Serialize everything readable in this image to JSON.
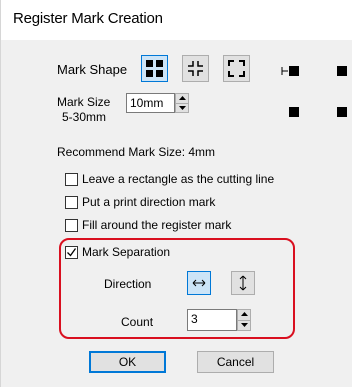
{
  "window": {
    "title": "Register Mark Creation"
  },
  "mark_shape": {
    "label": "Mark Shape",
    "options": [
      {
        "name": "square-blocks",
        "selected": true
      },
      {
        "name": "corner-cross",
        "selected": false
      },
      {
        "name": "corner-brackets",
        "selected": false
      }
    ]
  },
  "mark_size": {
    "label": "Mark Size",
    "range": "5-30mm",
    "value": "10mm"
  },
  "recommend": {
    "text": "Recommend Mark Size:  4mm"
  },
  "options": {
    "leave_rectangle": {
      "label": "Leave a rectangle as the cutting line",
      "checked": false
    },
    "print_direction": {
      "label": "Put a print direction mark",
      "checked": false
    },
    "fill_around": {
      "label": "Fill around the register mark",
      "checked": false
    },
    "mark_separation": {
      "label": "Mark Separation",
      "checked": true
    }
  },
  "separation": {
    "direction_label": "Direction",
    "direction_selected": "horizontal",
    "count_label": "Count",
    "count_value": "3"
  },
  "buttons": {
    "ok": "OK",
    "cancel": "Cancel"
  },
  "colors": {
    "highlight": "#d90f1f",
    "accent": "#0078d7"
  }
}
